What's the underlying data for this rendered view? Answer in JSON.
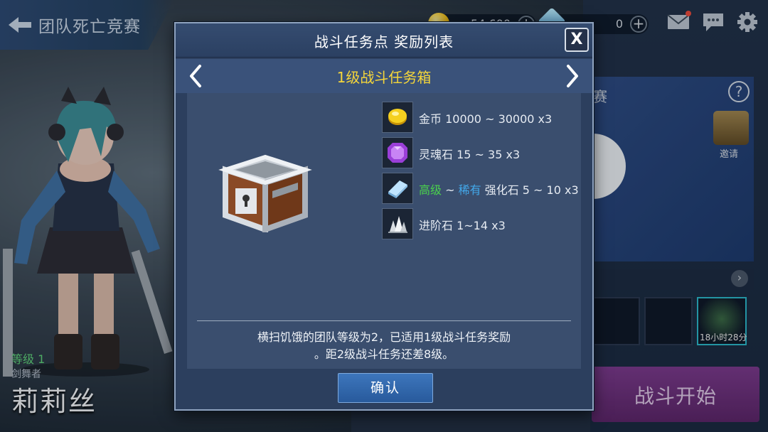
{
  "header": {
    "back_label": "团队死亡竞赛",
    "coins": "54,600",
    "gems": "0"
  },
  "character": {
    "level": "等级 1",
    "class": "剑舞者",
    "name": "莉莉丝"
  },
  "side": {
    "invite_label": "邀请",
    "slot_timer": "18小时28分",
    "start_button": "战斗开始"
  },
  "modal": {
    "title": "战斗任务点 奖励列表",
    "close_label": "X",
    "tier_title": "1级战斗任务箱",
    "rewards": [
      {
        "icon": "gold-coin-icon",
        "text": "金币 10000 ~ 30000 x3"
      },
      {
        "icon": "soul-stone-icon",
        "text": "灵魂石 15 ~ 35 x3"
      },
      {
        "icon": "enhance-stone-icon",
        "grade_high": "高级",
        "sep": " ~ ",
        "grade_rare": "稀有",
        "text": " 强化石 5 ~ 10 x3"
      },
      {
        "icon": "advance-stone-icon",
        "text": "进阶石 1~14 x3"
      }
    ],
    "description_line1": "横扫饥饿的团队等级为2，已适用1级战斗任务奖励",
    "description_line2": "。距2级战斗任务还差8级。",
    "confirm_label": "确认"
  },
  "colors": {
    "tier_title": "#f5d63a",
    "grade_high": "#4ad24c",
    "grade_rare": "#43a8ea",
    "confirm_button": "#3d76bc",
    "start_button": "#7a3a8c"
  }
}
